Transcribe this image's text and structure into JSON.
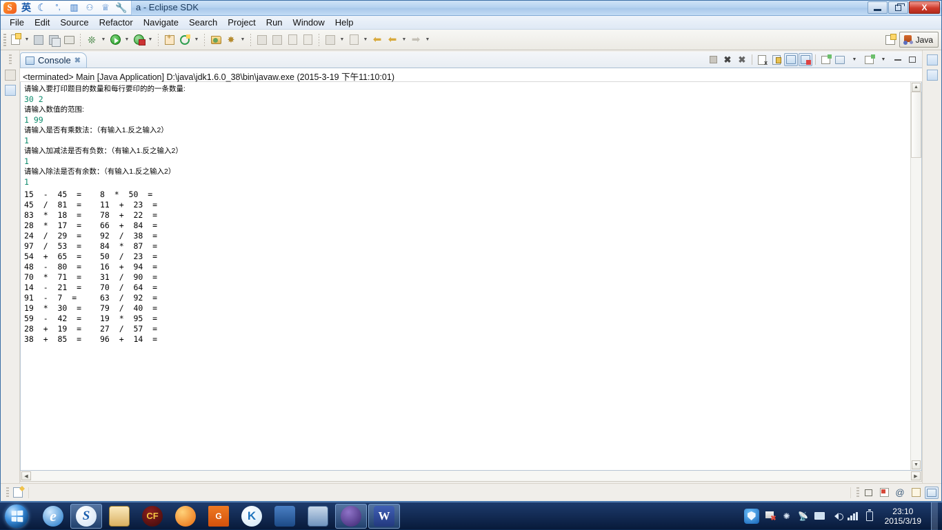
{
  "window": {
    "title": "a - Eclipse SDK",
    "minimize_label": "Minimize",
    "restore_label": "Restore",
    "close_label": "X"
  },
  "ime_bar": {
    "logo": "S",
    "items": [
      {
        "name": "ime-mode-chinese",
        "glyph": "英"
      },
      {
        "name": "ime-moon-icon",
        "glyph": "☾"
      },
      {
        "name": "ime-punctuation-icon",
        "glyph": "°,"
      },
      {
        "name": "ime-keyboard-icon",
        "glyph": "▥"
      },
      {
        "name": "ime-user-icon",
        "glyph": "⚇"
      },
      {
        "name": "ime-skin-icon",
        "glyph": "👕"
      },
      {
        "name": "ime-settings-icon",
        "glyph": "🔧"
      }
    ]
  },
  "menubar": {
    "items": [
      {
        "label": "File"
      },
      {
        "label": "Edit"
      },
      {
        "label": "Source"
      },
      {
        "label": "Refactor"
      },
      {
        "label": "Navigate"
      },
      {
        "label": "Search"
      },
      {
        "label": "Project"
      },
      {
        "label": "Run"
      },
      {
        "label": "Window"
      },
      {
        "label": "Help"
      }
    ]
  },
  "toolbar": {
    "buttons": [
      {
        "name": "new-wizard-button",
        "tooltip": "New"
      },
      {
        "name": "save-button",
        "tooltip": "Save"
      },
      {
        "name": "save-all-button",
        "tooltip": "Save All"
      },
      {
        "name": "print-button",
        "tooltip": "Print"
      },
      {
        "name": "debug-button",
        "tooltip": "Debug"
      },
      {
        "name": "run-button",
        "tooltip": "Run"
      },
      {
        "name": "external-tools-button",
        "tooltip": "External Tools"
      },
      {
        "name": "new-java-package-button",
        "tooltip": "New Java Package"
      },
      {
        "name": "new-java-class-button",
        "tooltip": "New Java Class"
      },
      {
        "name": "open-type-button",
        "tooltip": "Open Type"
      },
      {
        "name": "search-button",
        "tooltip": "Search"
      },
      {
        "name": "next-annotation-button",
        "tooltip": "Next Annotation"
      },
      {
        "name": "previous-annotation-button",
        "tooltip": "Previous Annotation"
      },
      {
        "name": "last-edit-location-button",
        "tooltip": "Last Edit Location"
      },
      {
        "name": "back-button",
        "tooltip": "Back"
      },
      {
        "name": "forward-button",
        "tooltip": "Forward"
      }
    ]
  },
  "perspective": {
    "open_perspective_label": "Open Perspective",
    "active_label": "Java"
  },
  "console_view": {
    "tab_label": "Console",
    "tab_close_glyph": "✖",
    "header": "<terminated> Main [Java Application] D:\\java\\jdk1.6.0_38\\bin\\javaw.exe (2015-3-19 下午11:10:01)",
    "tools": [
      {
        "name": "terminate-button",
        "tooltip": "Terminate"
      },
      {
        "name": "remove-launch-button",
        "tooltip": "Remove Launch"
      },
      {
        "name": "remove-all-terminated-button",
        "tooltip": "Remove All Terminated Launches"
      },
      {
        "name": "clear-console-button",
        "tooltip": "Clear Console"
      },
      {
        "name": "scroll-lock-button",
        "tooltip": "Scroll Lock"
      },
      {
        "name": "pin-console-button",
        "tooltip": "Pin Console"
      },
      {
        "name": "display-selected-console-button",
        "tooltip": "Display Selected Console"
      },
      {
        "name": "open-console-button",
        "tooltip": "Open Console"
      },
      {
        "name": "minimize-view-button",
        "tooltip": "Minimize"
      },
      {
        "name": "maximize-view-button",
        "tooltip": "Maximize"
      }
    ]
  },
  "console_output": {
    "lines": [
      {
        "type": "prompt",
        "text": "请输入要打印题目的数量和每行要印的的一条数量:"
      },
      {
        "type": "input",
        "text": "30 2"
      },
      {
        "type": "prompt",
        "text": "请输入数值的范围:"
      },
      {
        "type": "input",
        "text": "1 99"
      },
      {
        "type": "prompt",
        "text": "请输入是否有乘数法：（有输入1.反之输入2）"
      },
      {
        "type": "input",
        "text": "1"
      },
      {
        "type": "prompt",
        "text": "请输入加减法是否有负数：（有输入1.反之输入2）"
      },
      {
        "type": "input",
        "text": "1"
      },
      {
        "type": "prompt",
        "text": "请输入除法是否有余数：（有输入1.反之输入2）"
      },
      {
        "type": "input",
        "text": "1"
      }
    ],
    "problems": [
      {
        "left": "15  -  45  =",
        "right": "8  *  50  ="
      },
      {
        "left": "45  /  81  =",
        "right": "11  +  23  ="
      },
      {
        "left": "83  *  18  =",
        "right": "78  +  22  ="
      },
      {
        "left": "28  *  17  =",
        "right": "66  +  84  ="
      },
      {
        "left": "24  /  29  =",
        "right": "92  /  38  ="
      },
      {
        "left": "97  /  53  =",
        "right": "84  *  87  ="
      },
      {
        "left": "54  +  65  =",
        "right": "50  /  23  ="
      },
      {
        "left": "48  -  80  =",
        "right": "16  +  94  ="
      },
      {
        "left": "70  *  71  =",
        "right": "31  /  90  ="
      },
      {
        "left": "14  -  21  =",
        "right": "70  /  64  ="
      },
      {
        "left": "91  -  7  =",
        "right": "63  /  92  ="
      },
      {
        "left": "19  *  30  =",
        "right": "79  /  40  ="
      },
      {
        "left": "59  -  42  =",
        "right": "19  *  95  ="
      },
      {
        "left": "28  +  19  =",
        "right": "27  /  57  ="
      },
      {
        "left": "38  +  85  =",
        "right": "96  +  14  ="
      }
    ]
  },
  "scrollbars": {
    "up_glyph": "▲",
    "down_glyph": "▼",
    "left_glyph": "◀",
    "right_glyph": "▶"
  },
  "statusbar": {
    "trim_items": [
      {
        "name": "restore-trim-button"
      },
      {
        "name": "problems-trim-button"
      },
      {
        "name": "javadoc-trim-button"
      },
      {
        "name": "declaration-trim-button"
      },
      {
        "name": "console-trim-button"
      }
    ]
  },
  "taskbar": {
    "start_label": "Start",
    "items": [
      {
        "name": "taskbar-internet-explorer",
        "label": "Internet Explorer",
        "icon": "e",
        "style": "ie",
        "active": false
      },
      {
        "name": "taskbar-sogou",
        "label": "Sogou",
        "icon": "S",
        "style": "sogou",
        "active": true
      },
      {
        "name": "taskbar-file-manager",
        "label": "File Manager",
        "icon": "",
        "style": "files",
        "active": false
      },
      {
        "name": "taskbar-crossfire",
        "label": "CrossFire",
        "icon": "CF",
        "style": "cf",
        "active": false
      },
      {
        "name": "taskbar-firefox",
        "label": "Firefox",
        "icon": "",
        "style": "ff",
        "active": false
      },
      {
        "name": "taskbar-pdf-reader",
        "label": "PDF Reader",
        "icon": "G",
        "style": "pdf",
        "active": false
      },
      {
        "name": "taskbar-kingsoft",
        "label": "Kingsoft",
        "icon": "K",
        "style": "k",
        "active": false
      },
      {
        "name": "taskbar-media-player",
        "label": "Media Player",
        "icon": "",
        "style": "media",
        "active": false
      },
      {
        "name": "taskbar-wallpaper-tool",
        "label": "Wallpaper Tool",
        "icon": "",
        "style": "wall",
        "active": false
      },
      {
        "name": "taskbar-eclipse",
        "label": "Eclipse SDK",
        "icon": "",
        "style": "eclipse",
        "active": true
      },
      {
        "name": "taskbar-wps",
        "label": "WPS",
        "icon": "W",
        "style": "wps",
        "active": true
      }
    ],
    "tray": {
      "icons": [
        {
          "name": "tray-security-shield-icon"
        },
        {
          "name": "tray-action-center-flag-icon"
        },
        {
          "name": "tray-bluetooth-icon",
          "glyph": "✳"
        },
        {
          "name": "tray-network-icon"
        },
        {
          "name": "tray-display-icon"
        },
        {
          "name": "tray-volume-icon"
        },
        {
          "name": "tray-signal-icon"
        },
        {
          "name": "tray-battery-icon"
        }
      ],
      "time": "23:10",
      "date": "2015/3/19"
    }
  }
}
